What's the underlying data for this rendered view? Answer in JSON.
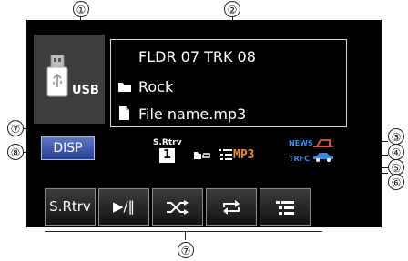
{
  "callouts": [
    "①",
    "②",
    "③",
    "④",
    "⑤",
    "⑥",
    "⑦",
    "⑧",
    "⑦"
  ],
  "source": {
    "label": "USB",
    "icon": "usb-drive-icon"
  },
  "track": {
    "folder_track": "FLDR 07 TRK 08",
    "genre": "Rock",
    "file_name": "File name.mp3"
  },
  "buttons": {
    "disp": "DISP",
    "srtrv": "S.Rtrv",
    "play_pause": "▶/‖"
  },
  "status": {
    "srtrv_label": "S.Rtrv",
    "srtrv_value": "1",
    "format": "MP3",
    "news": "NEWS",
    "trfc": "TRFC"
  },
  "colors": {
    "screen_bg": "#000000",
    "disp_button": "#3e5bb5",
    "mp3": "#e58e2d",
    "news_trfc": "#3c8be0",
    "news_icon": "#d84a3a"
  }
}
